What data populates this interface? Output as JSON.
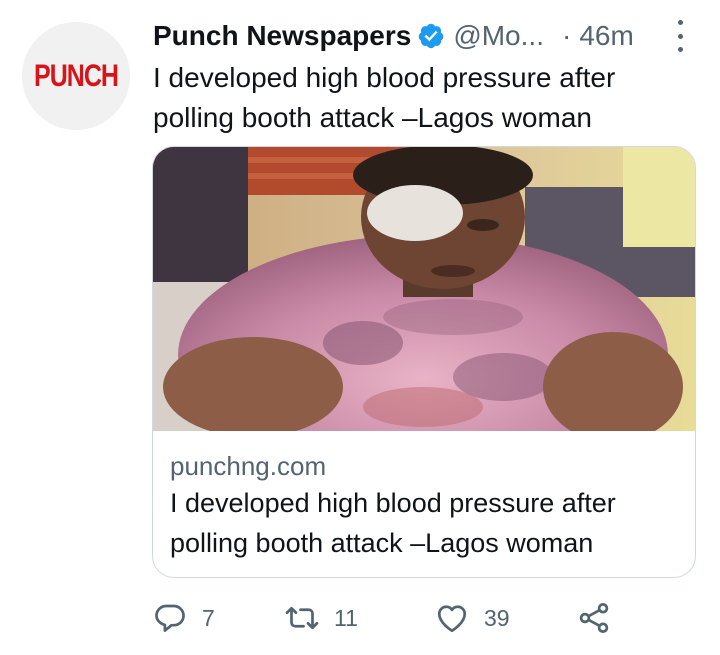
{
  "author": {
    "avatar_text": "PUNCH",
    "name": "Punch Newspapers",
    "handle": "@Mo...",
    "separator": "·",
    "time": "46m",
    "verified": true
  },
  "tweet": {
    "text": "I developed high blood pressure after polling booth attack –Lagos woman"
  },
  "card": {
    "domain": "punchng.com",
    "title": "I developed high blood pressure after polling booth attack –Lagos woman",
    "image": "photo-woman-with-bandaged-eye"
  },
  "actions": {
    "replies": "7",
    "retweets": "11",
    "likes": "39"
  },
  "colors": {
    "accent": "#1d9bf0",
    "brand": "#d8141b",
    "muted": "#536471"
  }
}
